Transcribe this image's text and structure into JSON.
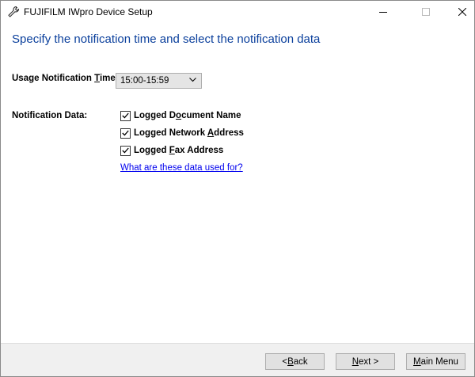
{
  "window": {
    "title": "FUJIFILM IWpro Device Setup",
    "app_icon": "wrench-icon"
  },
  "controls": {
    "minimize": "minimize-icon",
    "maximize": "maximize-icon",
    "close": "close-icon"
  },
  "heading": "Specify the notification time and select the notification data",
  "usage_time": {
    "label_pre": "Usage Notification ",
    "label_mnemonic": "T",
    "label_post": "ime:",
    "selected": "15:00-15:59"
  },
  "notification_data": {
    "label": "Notification Data:",
    "items": [
      {
        "pre": "Logged D",
        "mnemonic": "o",
        "post": "cument Name",
        "checked": true
      },
      {
        "pre": "Logged Network ",
        "mnemonic": "A",
        "post": "ddress",
        "checked": true
      },
      {
        "pre": "Logged ",
        "mnemonic": "F",
        "post": "ax Address",
        "checked": true
      }
    ],
    "help_link": "What are these data used for?"
  },
  "buttons": {
    "back_pre": "< ",
    "back_mnemonic": "B",
    "back_post": "ack",
    "next_pre": "",
    "next_mnemonic": "N",
    "next_post": "ext >",
    "menu_pre": "",
    "menu_mnemonic": "M",
    "menu_post": "ain Menu"
  }
}
